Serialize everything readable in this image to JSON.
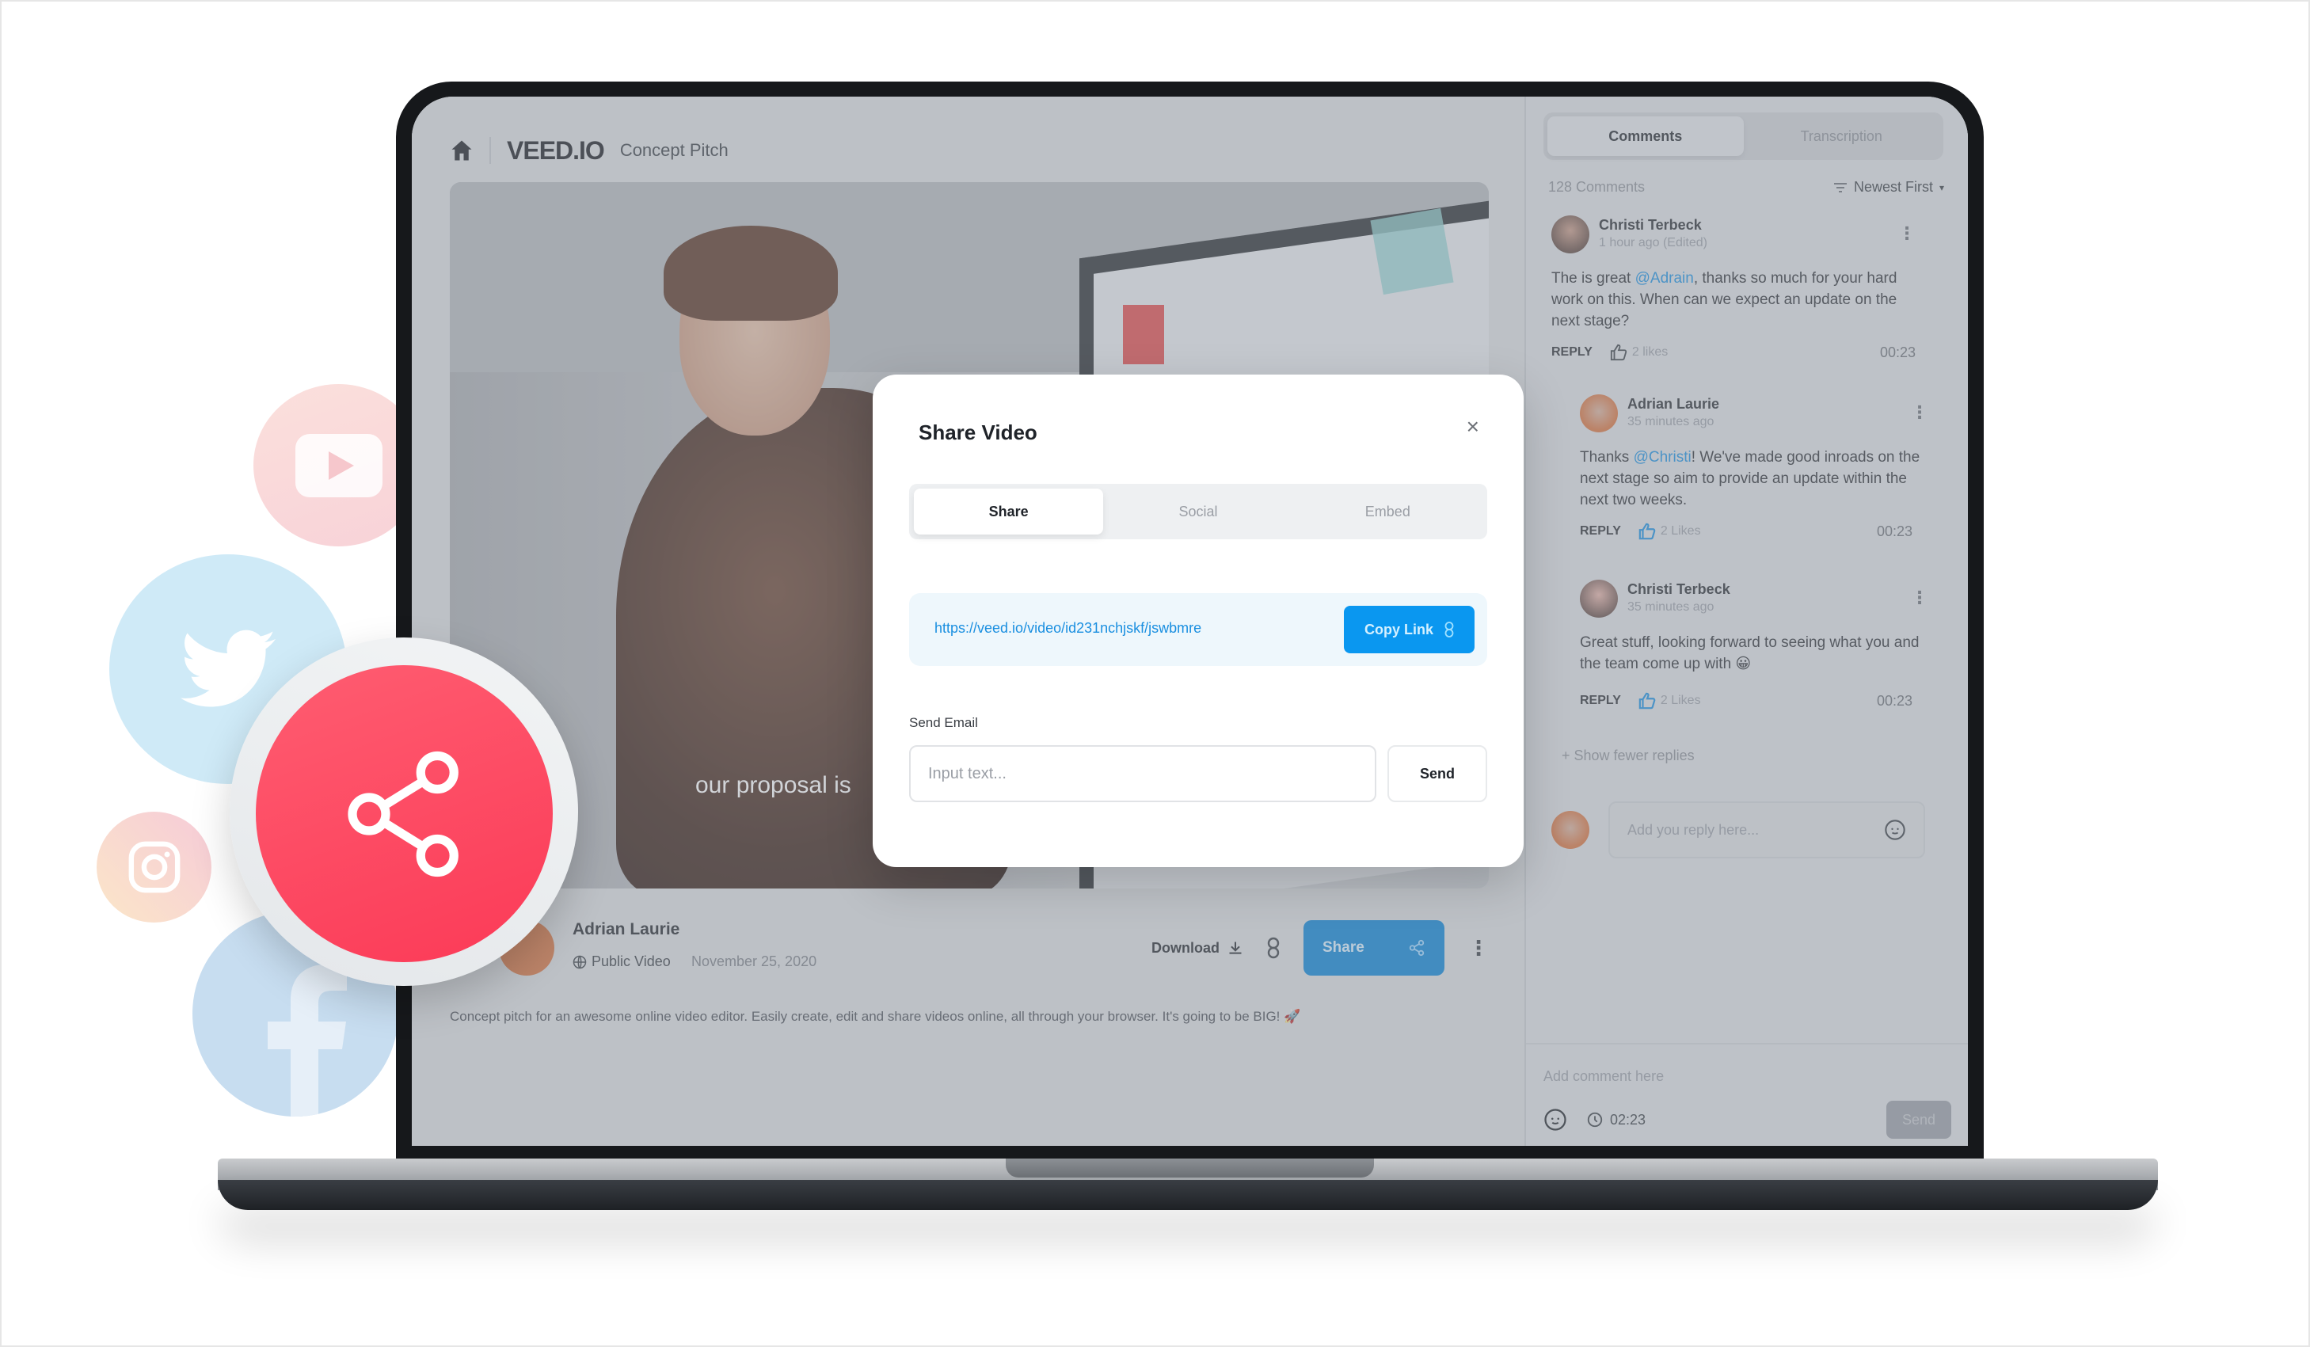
{
  "app": {
    "brand": "VEED.IO",
    "project_title": "Concept Pitch"
  },
  "video": {
    "caption": "our proposal is",
    "uploader": "Adrian Laurie",
    "visibility": "Public Video",
    "date": "November 25, 2020",
    "description": "Concept pitch for an awesome online video editor. Easily create, edit and share videos online, all through your browser. It's going to be BIG! 🚀",
    "actions": {
      "download_label": "Download",
      "share_label": "Share"
    }
  },
  "share_modal": {
    "title": "Share Video",
    "tabs": [
      {
        "label": "Share",
        "active": true
      },
      {
        "label": "Social",
        "active": false
      },
      {
        "label": "Embed",
        "active": false
      }
    ],
    "link_url": "https://veed.io/video/id231nchjskf/jswbmre",
    "copy_link_label": "Copy Link",
    "email_label": "Send Email",
    "email_placeholder": "Input text...",
    "send_label": "Send"
  },
  "sidebar": {
    "tabs": [
      {
        "label": "Comments",
        "active": true
      },
      {
        "label": "Transcription",
        "active": false
      }
    ],
    "comment_count": "128 Comments",
    "sort_label": "Newest First",
    "comments": [
      {
        "author": "Christi Terbeck",
        "time": "1 hour ago (Edited)",
        "text_before": "The is great ",
        "mention": "@Adrain",
        "text_after": ", thanks so much for your hard work on this. When can we expect an update on the next stage?",
        "reply_label": "REPLY",
        "likes": "2 likes",
        "timestamp": "00:23"
      },
      {
        "author": "Adrian Laurie",
        "time": "35 minutes ago",
        "text_before": "Thanks ",
        "mention": "@Christi",
        "text_after": "! We've made good inroads on the next stage so aim to provide an update within the next two weeks.",
        "reply_label": "REPLY",
        "likes": "2 Likes",
        "timestamp": "00:23"
      },
      {
        "author": "Christi Terbeck",
        "time": "35 minutes ago",
        "text_before": "Great stuff, looking forward to seeing what you and the team come up with 😀",
        "mention": "",
        "text_after": "",
        "reply_label": "REPLY",
        "likes": "2 Likes",
        "timestamp": "00:23"
      }
    ],
    "show_fewer_label": "+ Show fewer replies",
    "reply_placeholder": "Add you reply here...",
    "composer_placeholder": "Add comment here",
    "composer_time": "02:23",
    "composer_send_label": "Send"
  },
  "colors": {
    "accent_blue": "#0a97f0",
    "share_red": "#fb3a57",
    "mention_blue": "#1a8fe0"
  },
  "decorative_icons": [
    "youtube-icon",
    "twitter-icon",
    "instagram-icon",
    "facebook-icon",
    "share-icon"
  ]
}
